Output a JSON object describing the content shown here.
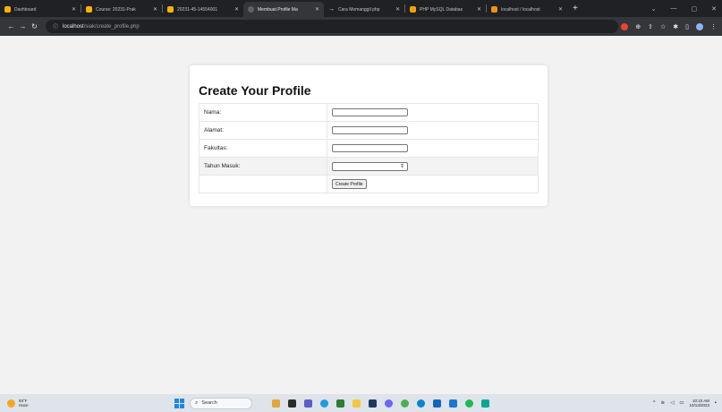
{
  "browser": {
    "tabs": [
      {
        "title": "Dashboard",
        "icon": "moodle-icon",
        "color": "#f6b400",
        "active": false
      },
      {
        "title": "Course: 20231-Prak",
        "icon": "moodle-icon",
        "color": "#f6b400",
        "active": false
      },
      {
        "title": "20231-45-14554001",
        "icon": "moodle-icon",
        "color": "#f6b400",
        "active": false
      },
      {
        "title": "Membuat Profile Ma",
        "icon": "globe-icon",
        "color": "#9aa0a6",
        "active": true
      },
      {
        "title": "Cara Memanggil php",
        "icon": "arrow-icon",
        "color": "#e8eaed",
        "active": false
      },
      {
        "title": "PHP MySQL Databas",
        "icon": "w3schools-icon",
        "color": "#f6a000",
        "active": false
      },
      {
        "title": "localhost / localhost",
        "icon": "phpmyadmin-icon",
        "color": "#f29111",
        "active": false
      }
    ],
    "new_tab": "+",
    "address": {
      "host": "localhost",
      "path": "/siak/create_profile.php"
    }
  },
  "form": {
    "title": "Create Your Profile",
    "fields": [
      {
        "label": "Nama:",
        "type": "text",
        "value": ""
      },
      {
        "label": "Alamat:",
        "type": "text",
        "value": ""
      },
      {
        "label": "Fakultas:",
        "type": "text",
        "value": ""
      },
      {
        "label": "Tahun Masuk:",
        "type": "select",
        "value": ""
      }
    ],
    "submit_label": "Create Profile"
  },
  "taskbar": {
    "weather_temp": "93°F",
    "weather_desc": "Haze",
    "search_label": "Search",
    "time": "10:10 AM",
    "date": "10/13/2023"
  }
}
